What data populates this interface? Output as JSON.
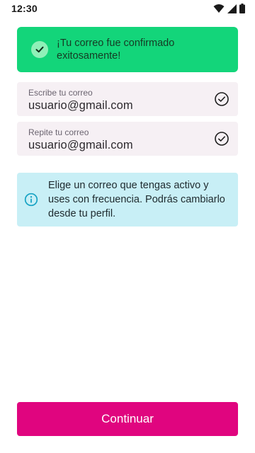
{
  "status_bar": {
    "time": "12:30",
    "icons": [
      "wifi-icon",
      "signal-icon",
      "battery-icon"
    ]
  },
  "toast": {
    "icon": "check-circle-icon",
    "message": "¡Tu correo fue confirmado exitosamente!",
    "background_color": "#13d57a"
  },
  "form": {
    "email": {
      "label": "Escribe tu correo",
      "value": "usuario@gmail.com",
      "status_icon": "check-circle-outline-icon"
    },
    "confirm_email": {
      "label": "Repite tu correo",
      "value": "usuario@gmail.com",
      "status_icon": "check-circle-outline-icon"
    }
  },
  "info": {
    "icon": "info-icon",
    "text": "Elige un correo que tengas activo y uses con frecuencia. Podrás cambiarlo desde tu perfil.",
    "background_color": "#c8eff6"
  },
  "actions": {
    "continue_label": "Continuar",
    "continue_color": "#e0057f"
  }
}
